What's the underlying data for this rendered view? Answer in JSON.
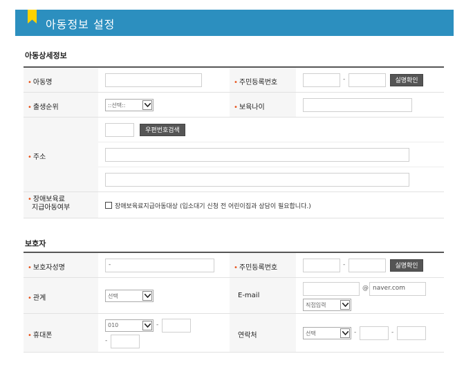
{
  "header": {
    "title": "아동정보 설정"
  },
  "child_section": {
    "title": "아동상세정보",
    "name_label": "아동명",
    "rrn_label": "주민등록번호",
    "rrn_dash": "-",
    "verify_button": "실명확인",
    "birth_order_label": "출생순위",
    "birth_order_value": "::선택::",
    "care_age_label": "보육나이",
    "address_label": "주소",
    "zip_search_button": "우편번호검색",
    "disability_label_line1": "장애보육료",
    "disability_label_line2": "지급아동여부",
    "disability_checkbox_label": "장애보육료지급아동대상 (입소대기 신청 전 어린이집과 상담이 필요합니다.)"
  },
  "guardian_section": {
    "title": "보호자",
    "name_label": "보호자성명",
    "name_value": "-",
    "rrn_label": "주민등록번호",
    "rrn_dash": "-",
    "verify_button": "실명확인",
    "relation_label": "관계",
    "relation_value": "선택",
    "email_label": "E-mail",
    "email_at": "@",
    "email_domain": "naver.com",
    "email_domain_select": "직접입력",
    "mobile_label": "휴대폰",
    "mobile_prefix": "010",
    "mobile_dash": "-",
    "contact_label": "연락처",
    "contact_select": "선택",
    "contact_dash": "-"
  }
}
